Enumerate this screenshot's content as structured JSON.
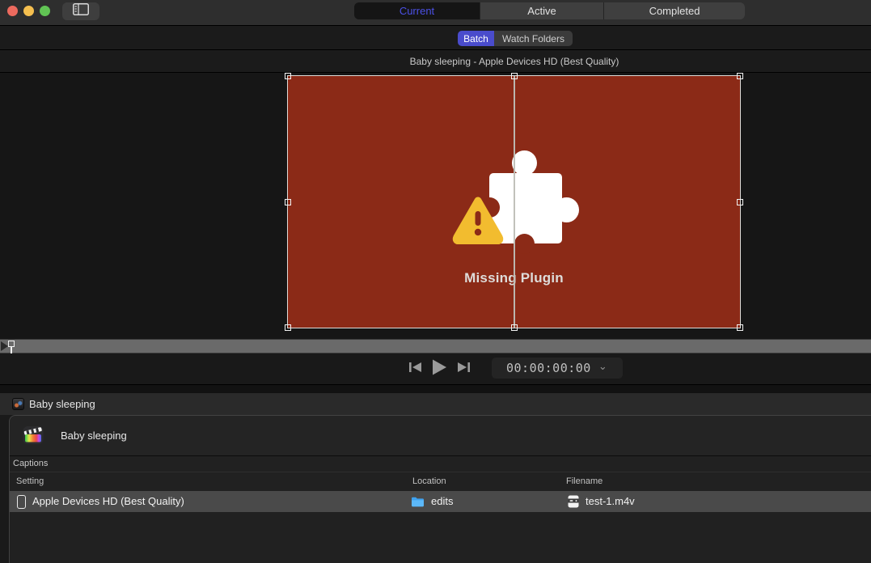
{
  "titlebar": {
    "view_tabs": [
      {
        "label": "Current",
        "selected": true
      },
      {
        "label": "Active",
        "selected": false
      },
      {
        "label": "Completed",
        "selected": false
      }
    ],
    "mode_tabs": [
      {
        "label": "Batch",
        "selected": true
      },
      {
        "label": "Watch Folders",
        "selected": false
      }
    ]
  },
  "preview": {
    "title": "Baby sleeping - Apple Devices HD (Best Quality)",
    "overlay_label": "Missing Plugin",
    "timecode": "00:00:00:00"
  },
  "batch": {
    "job_title": "Baby sleeping",
    "source_name": "Baby sleeping",
    "section_label": "Captions",
    "columns": {
      "setting": "Setting",
      "location": "Location",
      "filename": "Filename"
    },
    "outputs": [
      {
        "setting": "Apple Devices HD (Best Quality)",
        "location": "edits",
        "filename": "test-1.m4v"
      }
    ]
  },
  "icons": {
    "chevron_down": "⌄",
    "traffic_lights": [
      "close",
      "minimize",
      "zoom"
    ],
    "folder_color": "#3fa2f0",
    "warning_color": "#f2bc2f"
  },
  "colors": {
    "accent": "#4a4ccc",
    "accent_text": "#4b50e6",
    "frame_red": "#8b2a17",
    "selected_row": "#4a4a4a",
    "titlebar": "#2e2e2e"
  }
}
